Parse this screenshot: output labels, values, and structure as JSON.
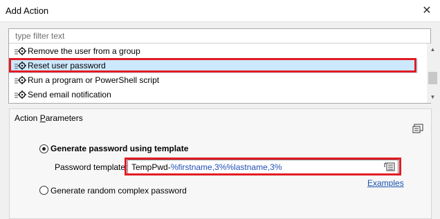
{
  "dialog": {
    "title": "Add Action",
    "close_icon": "close-icon"
  },
  "filter": {
    "placeholder": "type filter text",
    "value": ""
  },
  "actions": [
    {
      "label": "Remove the user from a group",
      "icon": "action-gear-icon",
      "selected": false
    },
    {
      "label": "Reset user password",
      "icon": "action-gear-icon",
      "selected": true
    },
    {
      "label": "Run a program or PowerShell script",
      "icon": "action-gear-icon",
      "selected": false
    },
    {
      "label": "Send email notification",
      "icon": "action-gear-icon",
      "selected": false
    }
  ],
  "params": {
    "group_title_underlined": "P",
    "group_title_prefix": "Action ",
    "group_title_rest": "arameters",
    "option_template": {
      "label": "Generate password using template",
      "selected": true
    },
    "template": {
      "label": "Password template:",
      "value_plain": "TempPwd-",
      "value_macro": "%firstname,3%%lastname,3%"
    },
    "examples_link": "Examples",
    "option_random": {
      "label": "Generate random complex password",
      "selected": false
    }
  },
  "colors": {
    "highlight": "#e31b23",
    "selection": "#cce8ff",
    "link": "#1a53b0"
  }
}
